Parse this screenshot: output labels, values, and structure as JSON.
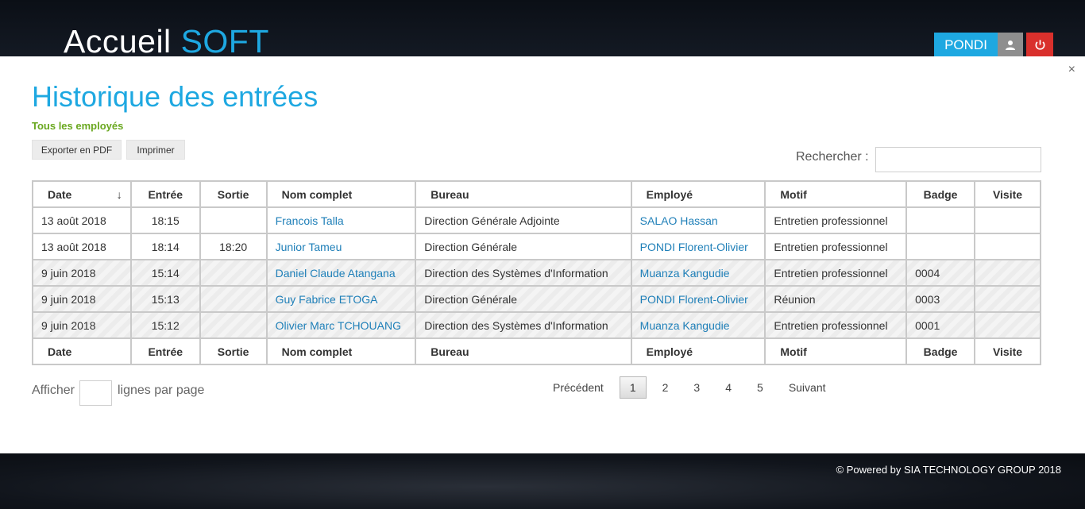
{
  "brand": {
    "part1": "Accueil ",
    "part2": "SOFT"
  },
  "user": {
    "name": "PONDI"
  },
  "icons": {
    "profile": "user-icon",
    "logout": "power-icon",
    "close": "close-icon"
  },
  "colors": {
    "accent": "#1ea8e1",
    "danger": "#d9302c",
    "subtitle": "#6aa820",
    "link": "#1e7fb8"
  },
  "modal": {
    "close_glyph": "×",
    "title": "Historique des entrées",
    "subtitle": "Tous les employés",
    "export_pdf": "Exporter en PDF",
    "print": "Imprimer",
    "search_label": "Rechercher :",
    "search_value": ""
  },
  "table": {
    "columns": [
      "Date",
      "Entrée",
      "Sortie",
      "Nom complet",
      "Bureau",
      "Employé",
      "Motif",
      "Badge",
      "Visite"
    ],
    "sort_arrow": "↓",
    "rows": [
      [
        "13 août 2018",
        "18:15",
        "",
        "Francois Talla",
        "Direction Générale Adjointe",
        "SALAO Hassan",
        "Entretien professionnel",
        "",
        ""
      ],
      [
        "13 août 2018",
        "18:14",
        "18:20",
        "Junior Tameu",
        "Direction Générale",
        "PONDI Florent-Olivier",
        "Entretien professionnel",
        "",
        ""
      ],
      [
        "9 juin 2018",
        "15:14",
        "",
        "Daniel Claude Atangana",
        "Direction des Systèmes d'Information",
        "Muanza Kangudie",
        "Entretien professionnel",
        "0004",
        ""
      ],
      [
        "9 juin 2018",
        "15:13",
        "",
        "Guy Fabrice ETOGA",
        "Direction Générale",
        "PONDI Florent-Olivier",
        "Réunion",
        "0003",
        ""
      ],
      [
        "9 juin 2018",
        "15:12",
        "",
        "Olivier Marc TCHOUANG",
        "Direction des Systèmes d'Information",
        "Muanza Kangudie",
        "Entretien professionnel",
        "0001",
        ""
      ]
    ]
  },
  "paging": {
    "show_label": "Afficher",
    "rows_value": "",
    "per_page_label": "lignes par page",
    "previous": "Précédent",
    "pages": [
      "1",
      "2",
      "3",
      "4",
      "5"
    ],
    "current_page": "1",
    "next": "Suivant"
  },
  "footer": {
    "text": "© Powered by SIA TECHNOLOGY GROUP 2018"
  }
}
